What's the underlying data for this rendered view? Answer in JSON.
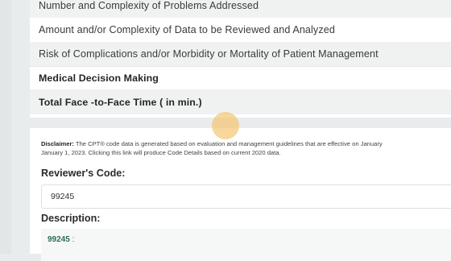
{
  "mdm_table": {
    "rows": [
      "Number and Complexity of Problems Addressed",
      "Amount and/or Complexity of Data to be Reviewed and Analyzed",
      "Risk of Complications and/or Morbidity or Mortality of Patient Management",
      "Medical Decision Making",
      "Total Face -to-Face Time ( in min.)"
    ]
  },
  "disclaimer": {
    "label": "Disclaimer:",
    "line1": " The CPT® code data is generated based on evaluation and management guidelines that are effective on January",
    "line2": "January 1, 2023. Clicking this link will produce Code Details based on current 2020 data."
  },
  "reviewer": {
    "label": "Reviewer's Code:",
    "value": "99245"
  },
  "description": {
    "label": "Description:",
    "code": "99245",
    "colon": " :"
  },
  "colors": {
    "code_accent": "#2f6b55",
    "cursor_highlight": "#f5be5f"
  }
}
